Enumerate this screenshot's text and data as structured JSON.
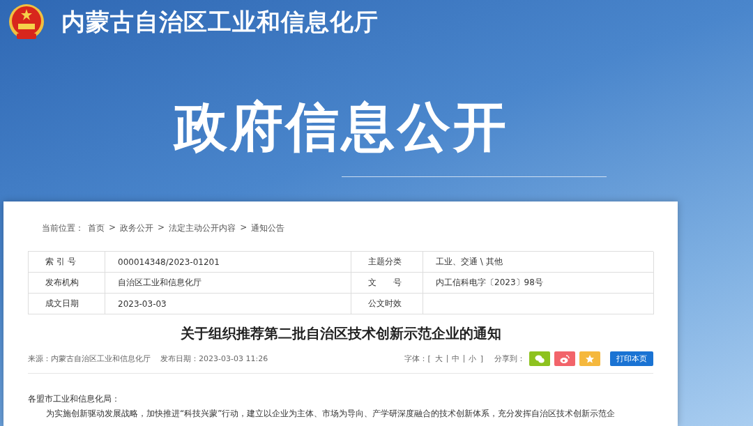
{
  "header": {
    "site_title": "内蒙古自治区工业和信息化厅",
    "banner_title": "政府信息公开"
  },
  "breadcrumb": {
    "label": "当前位置：",
    "items": [
      "首页",
      "政务公开",
      "法定主动公开内容",
      "通知公告"
    ],
    "separator": ">"
  },
  "info_table": [
    {
      "label_1": "索 引 号",
      "value_1": "000014348/2023-01201",
      "label_2": "主题分类",
      "value_2": "工业、交通 \\ 其他"
    },
    {
      "label_1": "发布机构",
      "value_1": "自治区工业和信息化厅",
      "label_2": "文　　号",
      "value_2": "内工信科电字〔2023〕98号"
    },
    {
      "label_1": "成文日期",
      "value_1": "2023-03-03",
      "label_2": "公文时效"
    }
  ],
  "article": {
    "title": "关于组织推荐第二批自治区技术创新示范企业的通知",
    "source": "来源：内蒙古自治区工业和信息化厅",
    "date": "发布日期：2023-03-03 11:26",
    "font_size_label": "字体：[",
    "font_sizes": [
      "大",
      "中",
      "小"
    ],
    "font_size_close": "]",
    "share_label": "分享到：",
    "share_buttons": [
      {
        "kind": "wechat",
        "color": "#8dc21f"
      },
      {
        "kind": "weibo",
        "color": "#f2646a"
      },
      {
        "kind": "favorite",
        "color": "#f5b83d"
      }
    ],
    "print_button": "打印本页",
    "salutation": "各盟市工业和信息化局：",
    "body": "为实施创新驱动发展战略，加快推进“科技兴蒙”行动，建立以企业为主体、市场为导向、产学研深度融合的技术创新体系，充分发挥自治区技术创新示范企"
  }
}
